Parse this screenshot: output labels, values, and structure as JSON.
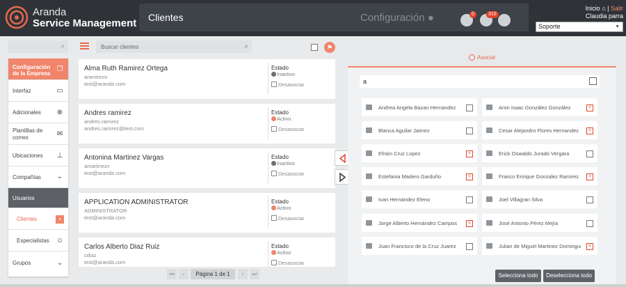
{
  "header": {
    "brand_line1": "Aranda",
    "brand_line2": "Service Management",
    "page_title": "Clientes",
    "section_title": "Configuración",
    "badge_1": "0",
    "badge_2": "310",
    "inicio_label": "Inicio",
    "salir_label": "Salir",
    "user_name": "Claudia parra",
    "role_selected": "Soporte"
  },
  "sidebar": {
    "items": [
      {
        "label": "Configuración de la Empresa",
        "icon": "copy-icon"
      },
      {
        "label": "Interfaz",
        "icon": "monitor-icon"
      },
      {
        "label": "Adicionales",
        "icon": "plus-circle-icon"
      },
      {
        "label": "Plantillas de correo",
        "icon": "mail-icon"
      },
      {
        "label": "Ubicaciones",
        "icon": "signpost-icon"
      },
      {
        "label": "Compañías",
        "icon": "chevron-down-icon"
      },
      {
        "label": "Usuarios",
        "icon": ""
      },
      {
        "label": "Clientes",
        "icon": "contact-card-icon"
      },
      {
        "label": "Especialistas",
        "icon": "support-agent-icon"
      },
      {
        "label": "Grupos",
        "icon": "chevron-down-icon"
      }
    ]
  },
  "list": {
    "search_placeholder": "Buscar clientes",
    "estado_label": "Estado",
    "desasociar_label": "Desasociar",
    "clients": [
      {
        "name": "Alma Ruth Ramirez Ortega",
        "user": "aramirezo",
        "email": "test@aranda.com",
        "status": "Inactivo"
      },
      {
        "name": "Andres ramirez",
        "user": "andres.ramirez",
        "email": "andres.ramirez@test.com",
        "status": "Activo"
      },
      {
        "name": "Antonina Martinez Vargas",
        "user": "amartinezv",
        "email": "test@aranda.com",
        "status": "Inactivo"
      },
      {
        "name": "APPLICATION ADMINISTRATOR",
        "user": "ADMINISTRATOR",
        "email": "test@aranda.com",
        "status": "Activo"
      },
      {
        "name": "Carlos Alberto Diaz Ruiz",
        "user": "cdiaz",
        "email": "test@aranda.com",
        "status": "Activo"
      }
    ],
    "pager_label": "Página 1 de 1"
  },
  "colors": {
    "accent": "#f0856b",
    "active": "#f0856b",
    "inactive": "#6b6f74"
  },
  "panel": {
    "tab_label": "Asociar",
    "search_value": "a",
    "people": [
      {
        "name": "Andrea Angela Bazan Hernandez",
        "linked": false
      },
      {
        "name": "Aron Isaac González González",
        "linked": true
      },
      {
        "name": "Blanca Aguilar Jaimez",
        "linked": false
      },
      {
        "name": "Cesar Alejandro Flores Hernandez",
        "linked": true
      },
      {
        "name": "Efraín Cruz Lopez",
        "linked": true
      },
      {
        "name": "Erick Oswaldo Jurado Vergara",
        "linked": false
      },
      {
        "name": "Estefania Madero Garduño",
        "linked": true
      },
      {
        "name": "Franco Enrique Gonzalez Ramirez",
        "linked": true
      },
      {
        "name": "Ivan Hernández Eleno",
        "linked": false
      },
      {
        "name": "Joel Villagran Silva",
        "linked": false
      },
      {
        "name": "Jorge Alberto Hernández Campos",
        "linked": true
      },
      {
        "name": "José Antonio Pérez Mejía",
        "linked": false
      },
      {
        "name": "Juan Francisco de la Cruz Juarez",
        "linked": false
      },
      {
        "name": "Julian de Miguel Martinez Dominguez",
        "linked": true
      }
    ],
    "select_all_label": "Selecciona todo",
    "deselect_all_label": "Deselecciona todo"
  }
}
